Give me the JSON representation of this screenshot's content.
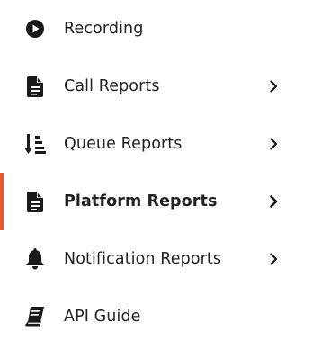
{
  "colors": {
    "text": "#222222",
    "icon": "#1a1a1a",
    "active_indicator": "#f0542c"
  },
  "menu": {
    "items": [
      {
        "label": "Recording",
        "icon": "play-circle-icon",
        "has_chevron": false,
        "active": false
      },
      {
        "label": "Call Reports",
        "icon": "document-icon",
        "has_chevron": true,
        "active": false
      },
      {
        "label": "Queue Reports",
        "icon": "sort-descending-icon",
        "has_chevron": true,
        "active": false
      },
      {
        "label": "Platform Reports",
        "icon": "document-icon",
        "has_chevron": true,
        "active": true
      },
      {
        "label": "Notification Reports",
        "icon": "bell-icon",
        "has_chevron": true,
        "active": false
      },
      {
        "label": "API Guide",
        "icon": "book-icon",
        "has_chevron": false,
        "active": false
      }
    ]
  }
}
